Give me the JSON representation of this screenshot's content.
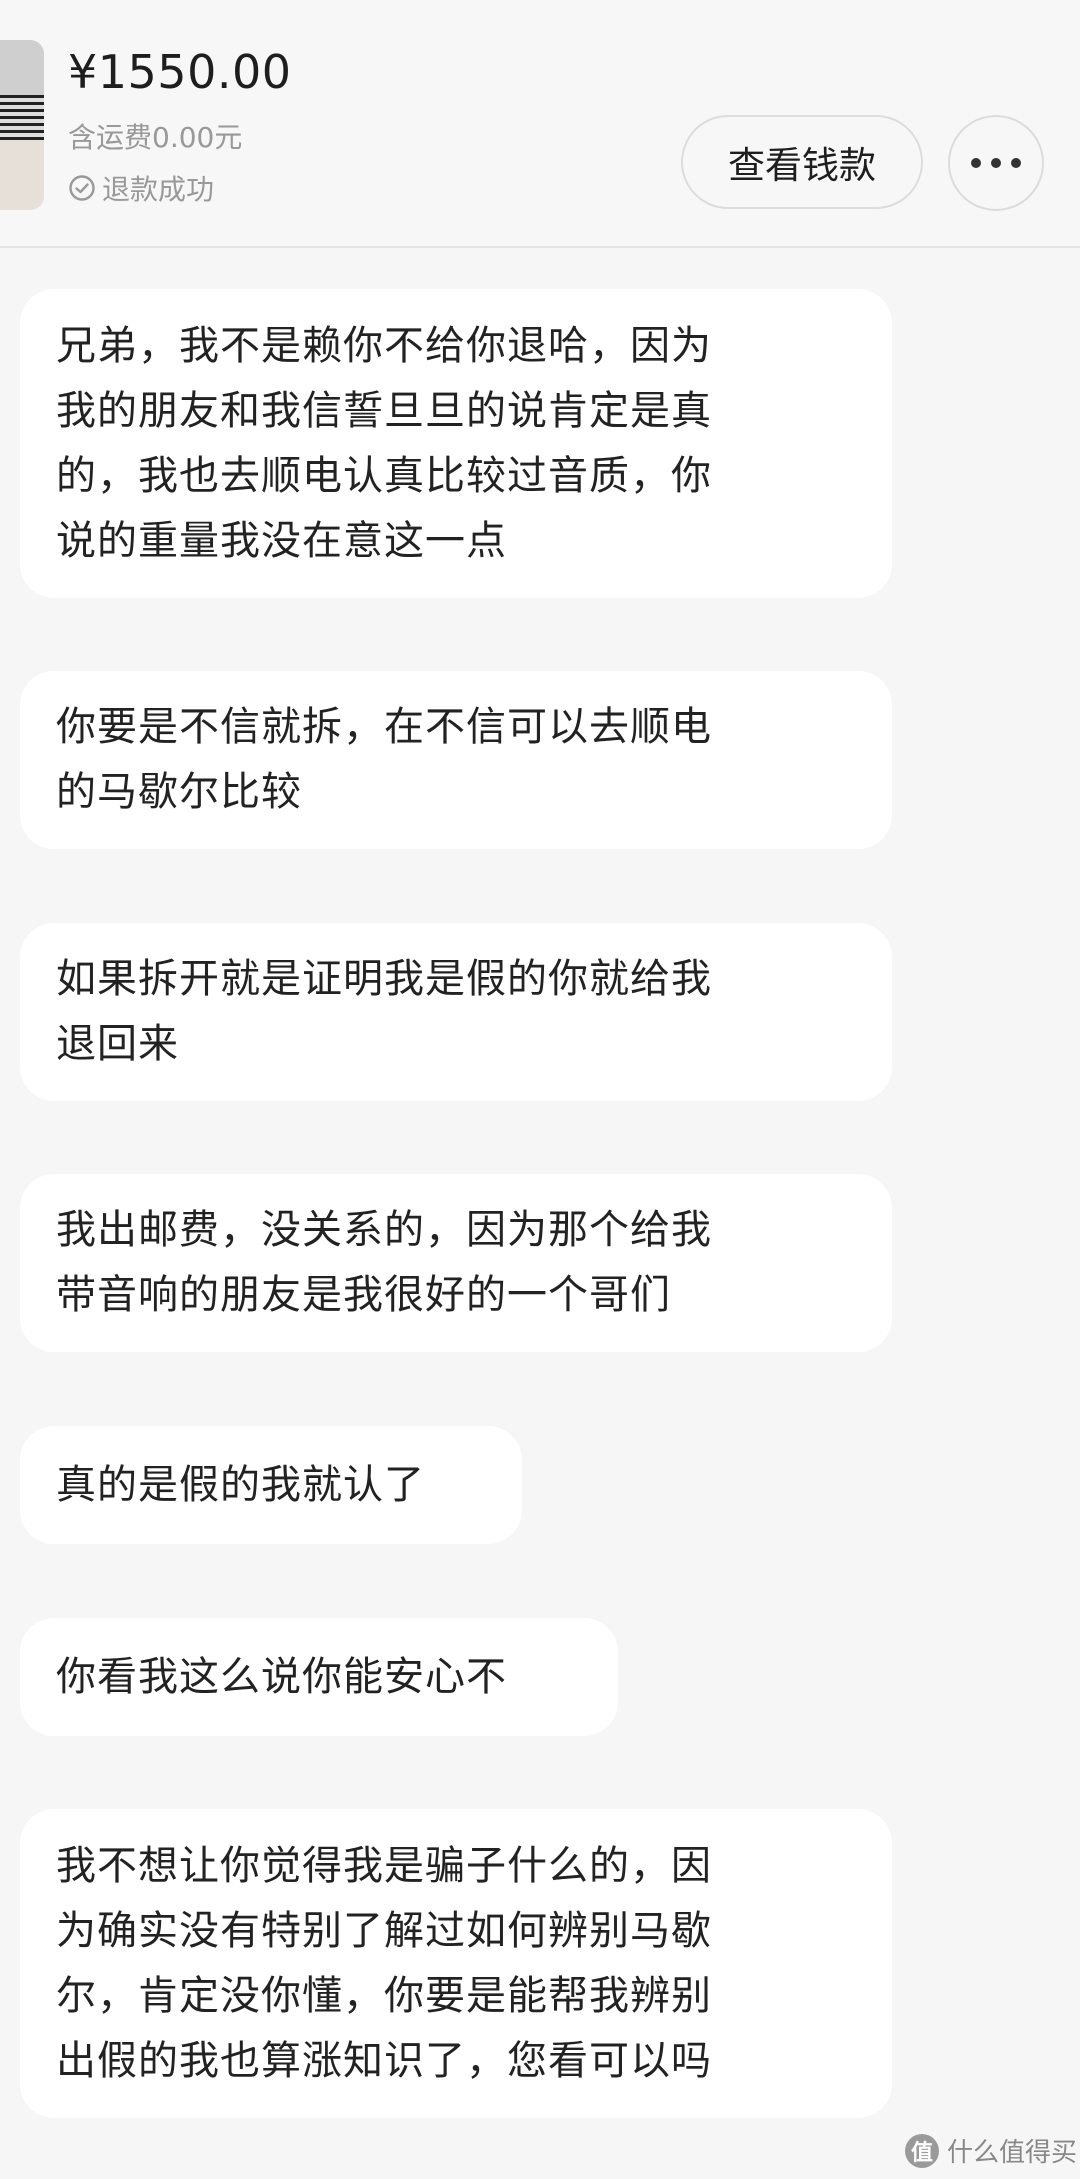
{
  "order": {
    "price": "¥1550.00",
    "shipping": "含运费0.00元",
    "status": "退款成功",
    "view_button_label": "查看钱款",
    "more_icon": "more-dots-icon",
    "status_icon": "check-circle-icon"
  },
  "messages": [
    {
      "text": "兄弟，我不是赖你不给你退哈，因为\n我的朋友和我信誓旦旦的说肯定是真\n的，我也去顺电认真比较过音质，你\n说的重量我没在意这一点"
    },
    {
      "text": "你要是不信就拆，在不信可以去顺电\n的马歇尔比较"
    },
    {
      "text": "如果拆开就是证明我是假的你就给我\n退回来"
    },
    {
      "text": "我出邮费，没关系的，因为那个给我\n带音响的朋友是我很好的一个哥们"
    },
    {
      "text": "真的是假的我就认了"
    },
    {
      "text": "你看我这么说你能安心不"
    },
    {
      "text": "我不想让你觉得我是骗子什么的，因\n为确实没有特别了解过如何辨别马歇\n尔，肯定没你懂，你要是能帮我辨别\n出假的我也算涨知识了，您看可以吗"
    }
  ],
  "watermark": {
    "logo_text": "值",
    "text": "什么值得买"
  }
}
